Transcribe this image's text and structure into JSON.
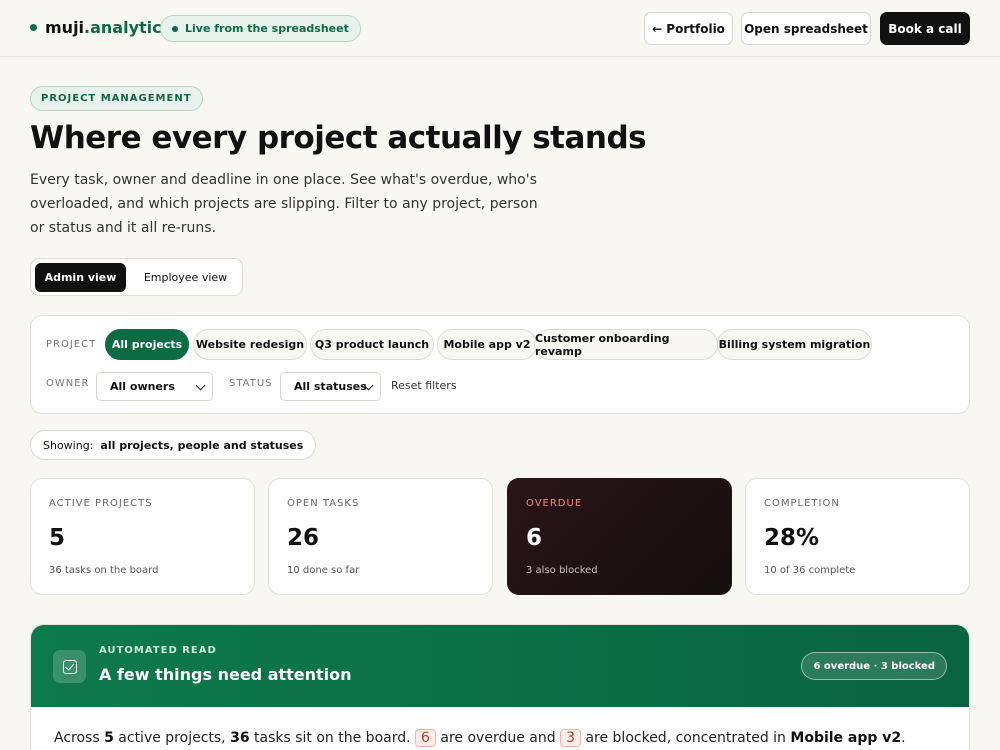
{
  "header": {
    "brand_prefix": "muji",
    "brand_suffix": ".analytics",
    "live_label": "Live from the spreadsheet",
    "portfolio_label": "← Portfolio",
    "open_sheet_label": "Open spreadsheet",
    "book_call_label": "Book a call"
  },
  "hero": {
    "eyebrow": "PROJECT MANAGEMENT",
    "title": "Where every project actually stands",
    "subtitle": "Every task, owner and deadline in one place. See what's overdue, who's overloaded, and which projects are slipping. Filter to any project, person or status and it all re-runs."
  },
  "view_toggle": {
    "admin": "Admin view",
    "employee": "Employee view",
    "selected": "Admin view"
  },
  "filters": {
    "project_label": "PROJECT",
    "projects": [
      "All projects",
      "Website redesign",
      "Q3 product launch",
      "Mobile app v2",
      "Customer onboarding revamp",
      "Billing system migration"
    ],
    "selected_project": "All projects",
    "owner_label": "OWNER",
    "owner_value": "All owners",
    "status_label": "STATUS",
    "status_value": "All statuses",
    "reset_label": "Reset filters"
  },
  "showing": {
    "label": "Showing:",
    "value": "all projects, people and statuses"
  },
  "kpis": [
    {
      "label": "ACTIVE PROJECTS",
      "value": "5",
      "sub": "36 tasks on the board"
    },
    {
      "label": "OPEN TASKS",
      "value": "26",
      "sub": "10 done so far"
    },
    {
      "label": "OVERDUE",
      "value": "6",
      "sub": "3 also blocked"
    },
    {
      "label": "COMPLETION",
      "value": "28%",
      "sub": "10 of 36 complete"
    }
  ],
  "attention": {
    "eyebrow": "AUTOMATED READ",
    "title": "A few things need attention",
    "badge": "6 overdue · 3 blocked",
    "body": {
      "t1": "Across ",
      "n_projects": "5",
      "t2": " active projects, ",
      "n_tasks": "36",
      "t3": " tasks sit on the board. ",
      "n_overdue": "6",
      "t4": " are overdue and ",
      "n_blocked": "3",
      "t5": " are blocked, concentrated in ",
      "project": "Mobile app v2",
      "t6": "."
    }
  },
  "colors": {
    "accent_green": "#0d6b43",
    "dark": "#111111",
    "alert": "#c2412a"
  }
}
